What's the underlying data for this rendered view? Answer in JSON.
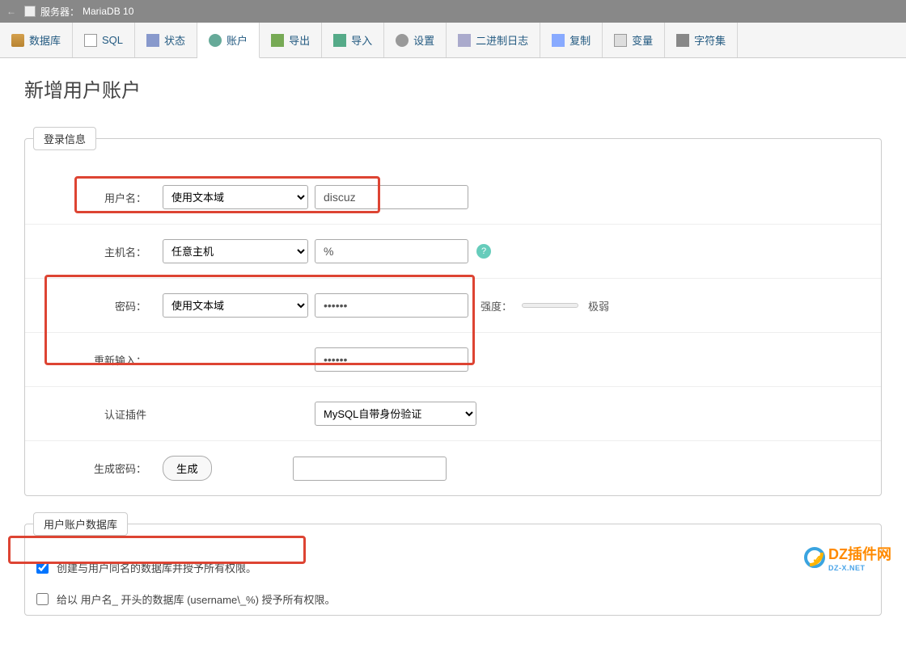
{
  "topbar": {
    "back": "←",
    "server_label": "服务器：",
    "server_name": "MariaDB 10"
  },
  "tabs": [
    {
      "label": "数据库",
      "icon": "icon-db"
    },
    {
      "label": "SQL",
      "icon": "icon-sql"
    },
    {
      "label": "状态",
      "icon": "icon-status"
    },
    {
      "label": "账户",
      "icon": "icon-user",
      "active": true
    },
    {
      "label": "导出",
      "icon": "icon-export"
    },
    {
      "label": "导入",
      "icon": "icon-import"
    },
    {
      "label": "设置",
      "icon": "icon-settings"
    },
    {
      "label": "二进制日志",
      "icon": "icon-binlog"
    },
    {
      "label": "复制",
      "icon": "icon-repl"
    },
    {
      "label": "变量",
      "icon": "icon-vars"
    },
    {
      "label": "字符集",
      "icon": "icon-charset"
    }
  ],
  "page_title": "新增用户账户",
  "login_legend": "登录信息",
  "form": {
    "username_label": "用户名：",
    "username_select": "使用文本域",
    "username_value": "discuz",
    "hostname_label": "主机名：",
    "hostname_select": "任意主机",
    "hostname_value": "%",
    "password_label": "密码：",
    "password_select": "使用文本域",
    "password_value": "••••••",
    "retype_label": "重新输入：",
    "retype_value": "••••••",
    "strength_label": "强度：",
    "strength_text": "极弱",
    "auth_label": "认证插件",
    "auth_select": "MySQL自带身份验证",
    "gen_label": "生成密码：",
    "gen_btn": "生成"
  },
  "db_legend": "用户账户数据库",
  "checkboxes": {
    "create_db_checked": true,
    "create_db_label": "创建与用户同名的数据库并授予所有权限。",
    "grant_wildcard_checked": false,
    "grant_wildcard_label": "给以 用户名_ 开头的数据库 (username\\_%) 授予所有权限。"
  },
  "watermark": {
    "text": "DZ插件网",
    "sub": "DZ-X.NET"
  }
}
